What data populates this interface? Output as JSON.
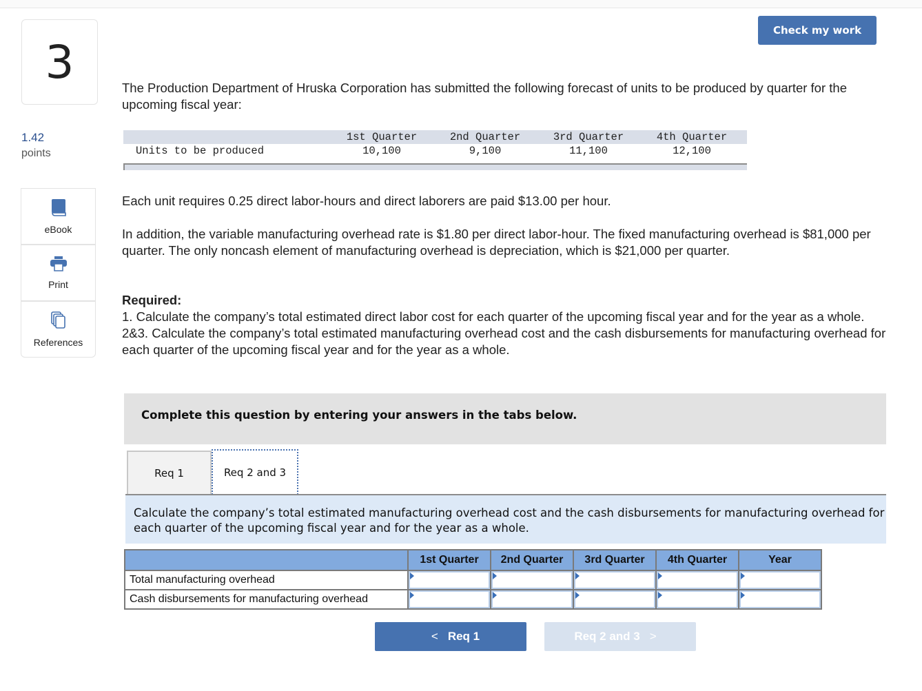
{
  "question": {
    "number": "3",
    "points_value": "1.42",
    "points_label": "points"
  },
  "sidebar": {
    "tools": [
      {
        "label": "eBook",
        "icon": "book-icon"
      },
      {
        "label": "Print",
        "icon": "printer-icon"
      },
      {
        "label": "References",
        "icon": "references-icon"
      }
    ]
  },
  "header": {
    "check_button": "Check my work"
  },
  "problem": {
    "intro": "The Production Department of Hruska Corporation has submitted the following forecast of units to be produced by quarter for the upcoming fiscal year:",
    "units_table": {
      "headers": [
        "",
        "1st Quarter",
        "2nd Quarter",
        "3rd Quarter",
        "4th Quarter"
      ],
      "row_label": "Units to be produced",
      "values": [
        "10,100",
        "9,100",
        "11,100",
        "12,100"
      ]
    },
    "labor_text": "Each unit requires 0.25 direct labor-hours and direct laborers are paid $13.00 per hour.",
    "overhead_text": "In addition, the variable manufacturing overhead rate is $1.80 per direct labor-hour. The fixed manufacturing overhead is $81,000 per quarter. The only noncash element of manufacturing overhead is depreciation, which is $21,000 per quarter.",
    "required_heading": "Required:",
    "required_1": "1. Calculate the company’s total estimated direct labor cost for each quarter of the upcoming fiscal year and for the year as a whole.",
    "required_23": "2&3. Calculate the company’s total estimated manufacturing overhead cost and the cash disbursements for manufacturing overhead for each quarter of the upcoming fiscal year and for the year as a whole."
  },
  "instructions": "Complete this question by entering your answers in the tabs below.",
  "tabs": [
    {
      "label": "Req 1",
      "active": false
    },
    {
      "label": "Req 2 and 3",
      "active": true
    }
  ],
  "req_description": "Calculate the company’s total estimated manufacturing overhead cost and the cash disbursements for manufacturing overhead for each quarter of the upcoming fiscal year and for the year as a whole.",
  "answer_table": {
    "headers": [
      "",
      "1st Quarter",
      "2nd Quarter",
      "3rd Quarter",
      "4th Quarter",
      "Year"
    ],
    "rows": [
      {
        "label": "Total manufacturing overhead",
        "values": [
          "",
          "",
          "",
          "",
          ""
        ]
      },
      {
        "label": "Cash disbursements for manufacturing overhead",
        "values": [
          "",
          "",
          "",
          "",
          ""
        ]
      }
    ]
  },
  "navigation": {
    "prev_label": "Req 1",
    "next_label": "Req 2 and 3",
    "prev_icon": "chevron-left-icon",
    "next_icon": "chevron-right-icon"
  },
  "colors": {
    "accent": "#4672b0",
    "header_blue": "#82aade",
    "desc_bg": "#dde9f7",
    "points_color": "#2a4f8f"
  }
}
